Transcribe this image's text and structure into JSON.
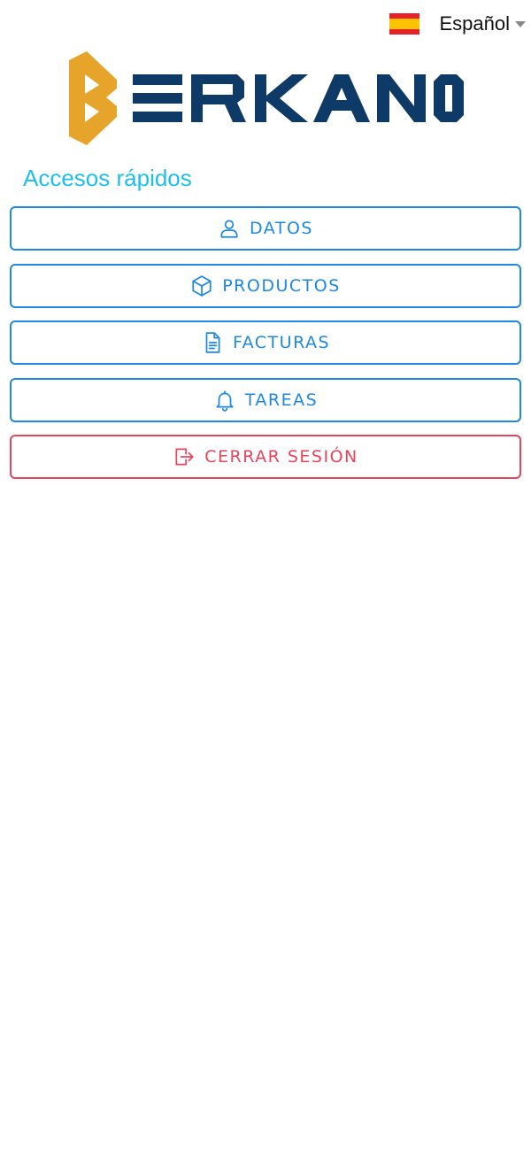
{
  "language": {
    "label": "Español",
    "flag_colors": [
      "#e8202a",
      "#fcc400"
    ]
  },
  "brand": {
    "logo_text": "BERKANO",
    "colors": {
      "accent": "#e6a42b",
      "primary": "#0d3a66"
    }
  },
  "quick_access": {
    "title": "Accesos rápidos",
    "items": [
      {
        "label": "DATOS",
        "icon": "user-icon"
      },
      {
        "label": "PRODUCTOS",
        "icon": "box-icon"
      },
      {
        "label": "FACTURAS",
        "icon": "document-icon"
      },
      {
        "label": "TAREAS",
        "icon": "bell-icon"
      },
      {
        "label": "CERRAR SESIÓN",
        "icon": "logout-icon"
      }
    ]
  },
  "colors": {
    "title": "#1ec0ea",
    "button": "#1e88e5",
    "danger": "#e8455a"
  }
}
